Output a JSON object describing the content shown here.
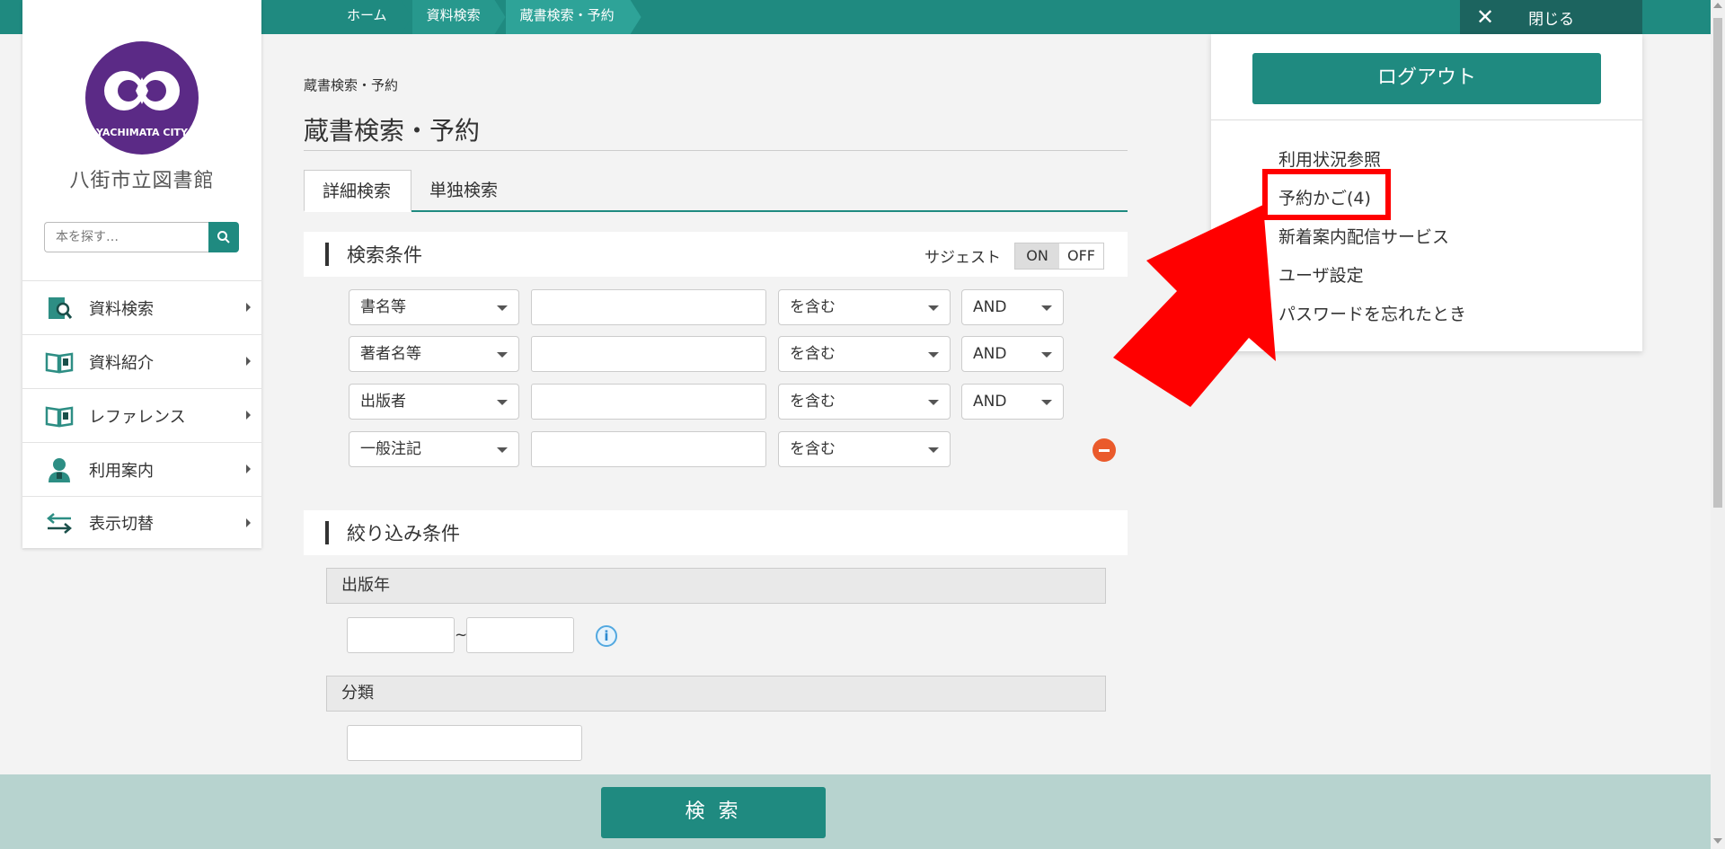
{
  "topbar": {
    "breadcrumbs": [
      "ホーム",
      "資料検索",
      "蔵書検索・予約"
    ],
    "close_label": "閉じる",
    "close_icon": "close-icon"
  },
  "sidebar": {
    "logo_caption": "YACHIMATA CITY",
    "library_name": "八街市立図書館",
    "search_placeholder": "本を探す…",
    "items": [
      {
        "label": "資料検索",
        "icon": "book-search-icon"
      },
      {
        "label": "資料紹介",
        "icon": "open-book-icon"
      },
      {
        "label": "レファレンス",
        "icon": "open-book-icon"
      },
      {
        "label": "利用案内",
        "icon": "person-icon"
      },
      {
        "label": "表示切替",
        "icon": "switch-arrows-icon"
      }
    ]
  },
  "main": {
    "breadcrumb": "蔵書検索・予約",
    "title": "蔵書検索・予約",
    "tabs": [
      "詳細検索",
      "単独検索"
    ],
    "conditions": {
      "heading": "検索条件",
      "suggest_label": "サジェスト",
      "toggle_on": "ON",
      "toggle_off": "OFF",
      "rows": [
        {
          "field": "書名等",
          "match": "を含む",
          "op": "AND"
        },
        {
          "field": "著者名等",
          "match": "を含む",
          "op": "AND"
        },
        {
          "field": "出版者",
          "match": "を含む",
          "op": "AND"
        },
        {
          "field": "一般注記",
          "match": "を含む"
        }
      ]
    },
    "filters": {
      "heading": "絞り込み条件",
      "year_label": "出版年",
      "range_sep": "~",
      "info_symbol": "i",
      "class_label": "分類"
    },
    "search_button": "検 索"
  },
  "panel": {
    "logout": "ログアウト",
    "menu": [
      "利用状況参照",
      "予約かご(4)",
      "新着案内配信サービス",
      "ユーザ設定",
      "パスワードを忘れたとき"
    ]
  },
  "colors": {
    "accent": "#1f8a80",
    "highlight": "#ff0000",
    "logo": "#5b2a86"
  }
}
